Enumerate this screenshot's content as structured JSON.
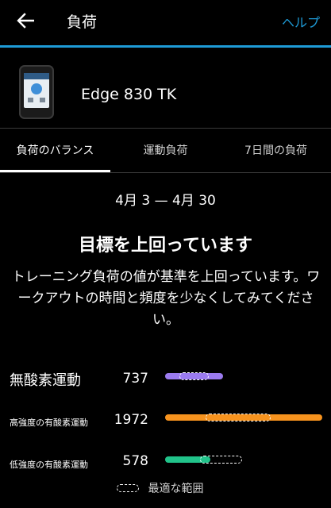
{
  "header": {
    "title": "負荷",
    "help_label": "ヘルプ",
    "accent_color": "#1e9bd7"
  },
  "device": {
    "name": "Edge 830 TK"
  },
  "tabs": [
    {
      "label": "負荷のバランス",
      "active": true
    },
    {
      "label": "運動負荷",
      "active": false
    },
    {
      "label": "7日間の負荷",
      "active": false
    }
  ],
  "summary": {
    "date_range": "4月 3 — 4月 30",
    "headline": "目標を上回っています",
    "message": "トレーニング負荷の値が基準を上回っています。ワークアウトの時間と頻度を少なくしてみてください。"
  },
  "loads": [
    {
      "label": "無酸素運動",
      "value": "737",
      "fill": 0.37,
      "optimal_start": 0.09,
      "optimal_end": 0.27,
      "color": "#9b7bef"
    },
    {
      "label": "高強度の有酸素運動",
      "value": "1972",
      "fill": 1.0,
      "optimal_start": 0.26,
      "optimal_end": 0.66,
      "color": "#f7931e"
    },
    {
      "label": "低強度の有酸素運動",
      "value": "578",
      "fill": 0.29,
      "optimal_start": 0.22,
      "optimal_end": 0.48,
      "color": "#21c38a"
    }
  ],
  "legend": {
    "label": "最適な範囲"
  }
}
